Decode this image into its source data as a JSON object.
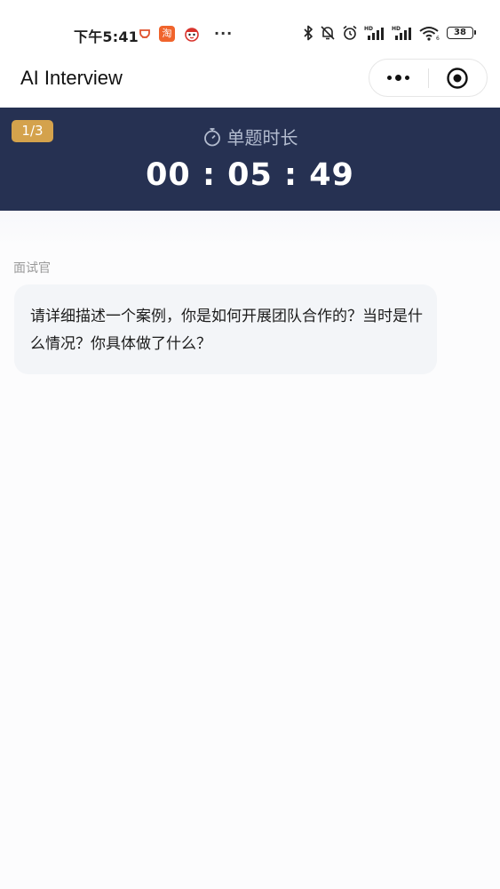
{
  "status_bar": {
    "time": "下午5:41",
    "taobao_char": "淘",
    "more": "···",
    "battery": "38"
  },
  "nav": {
    "title": "AI Interview"
  },
  "timer": {
    "progress": "1/3",
    "label": "单题时长",
    "value": "00 : 05 : 49"
  },
  "chat": {
    "sender": "面试官",
    "message": "请详细描述一个案例，你是如何开展团队合作的？当时是什么情况？你具体做了什么？"
  },
  "colors": {
    "banner": "#263152",
    "badge": "#d4a24c",
    "bubble": "#f3f5f8"
  }
}
